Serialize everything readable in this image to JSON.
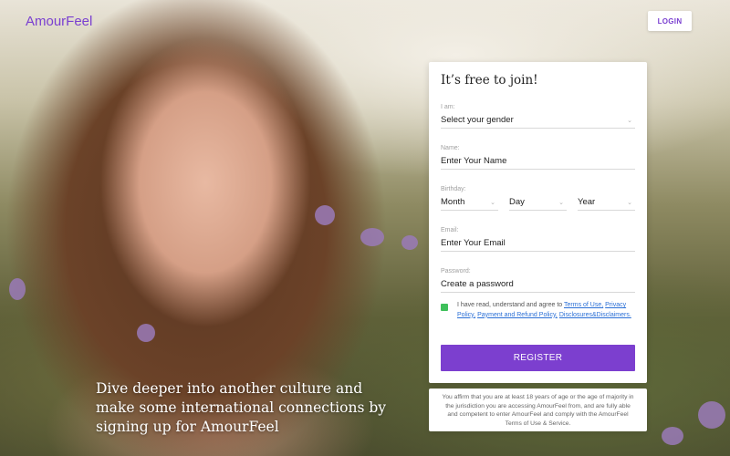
{
  "brand": {
    "name": "AmourFeel",
    "accent": "#7a3fd0"
  },
  "header": {
    "login_label": "LOGIN"
  },
  "tagline": "Dive deeper into another culture and make some international connections by signing up for AmourFeel",
  "form": {
    "title": "It’s free to join!",
    "gender": {
      "label": "I am:",
      "value": "Select your gender"
    },
    "name": {
      "label": "Name:",
      "placeholder": "Enter Your Name"
    },
    "birthday": {
      "label": "Birthday:",
      "month": "Month",
      "day": "Day",
      "year": "Year"
    },
    "email": {
      "label": "Email:",
      "placeholder": "Enter Your Email"
    },
    "password": {
      "label": "Password:",
      "placeholder": "Create a password"
    },
    "agree": {
      "text": "I have read, understand and agree to ",
      "links": [
        "Terms of Use,",
        "Privacy Policy,",
        "Payment and Refund Policy,",
        "Disclosures&Disclaimers."
      ],
      "checkbox_color": "#3fc05b"
    },
    "register_label": "REGISTER",
    "register_color": "#7c3fcf"
  },
  "disclaimer": "You affirm that you are at least 18 years of age or the age of majority in the jurisdiction you are accessing AmourFeel from, and are fully able and competent to enter AmourFeel and comply with the AmourFeel Terms of Use & Service."
}
